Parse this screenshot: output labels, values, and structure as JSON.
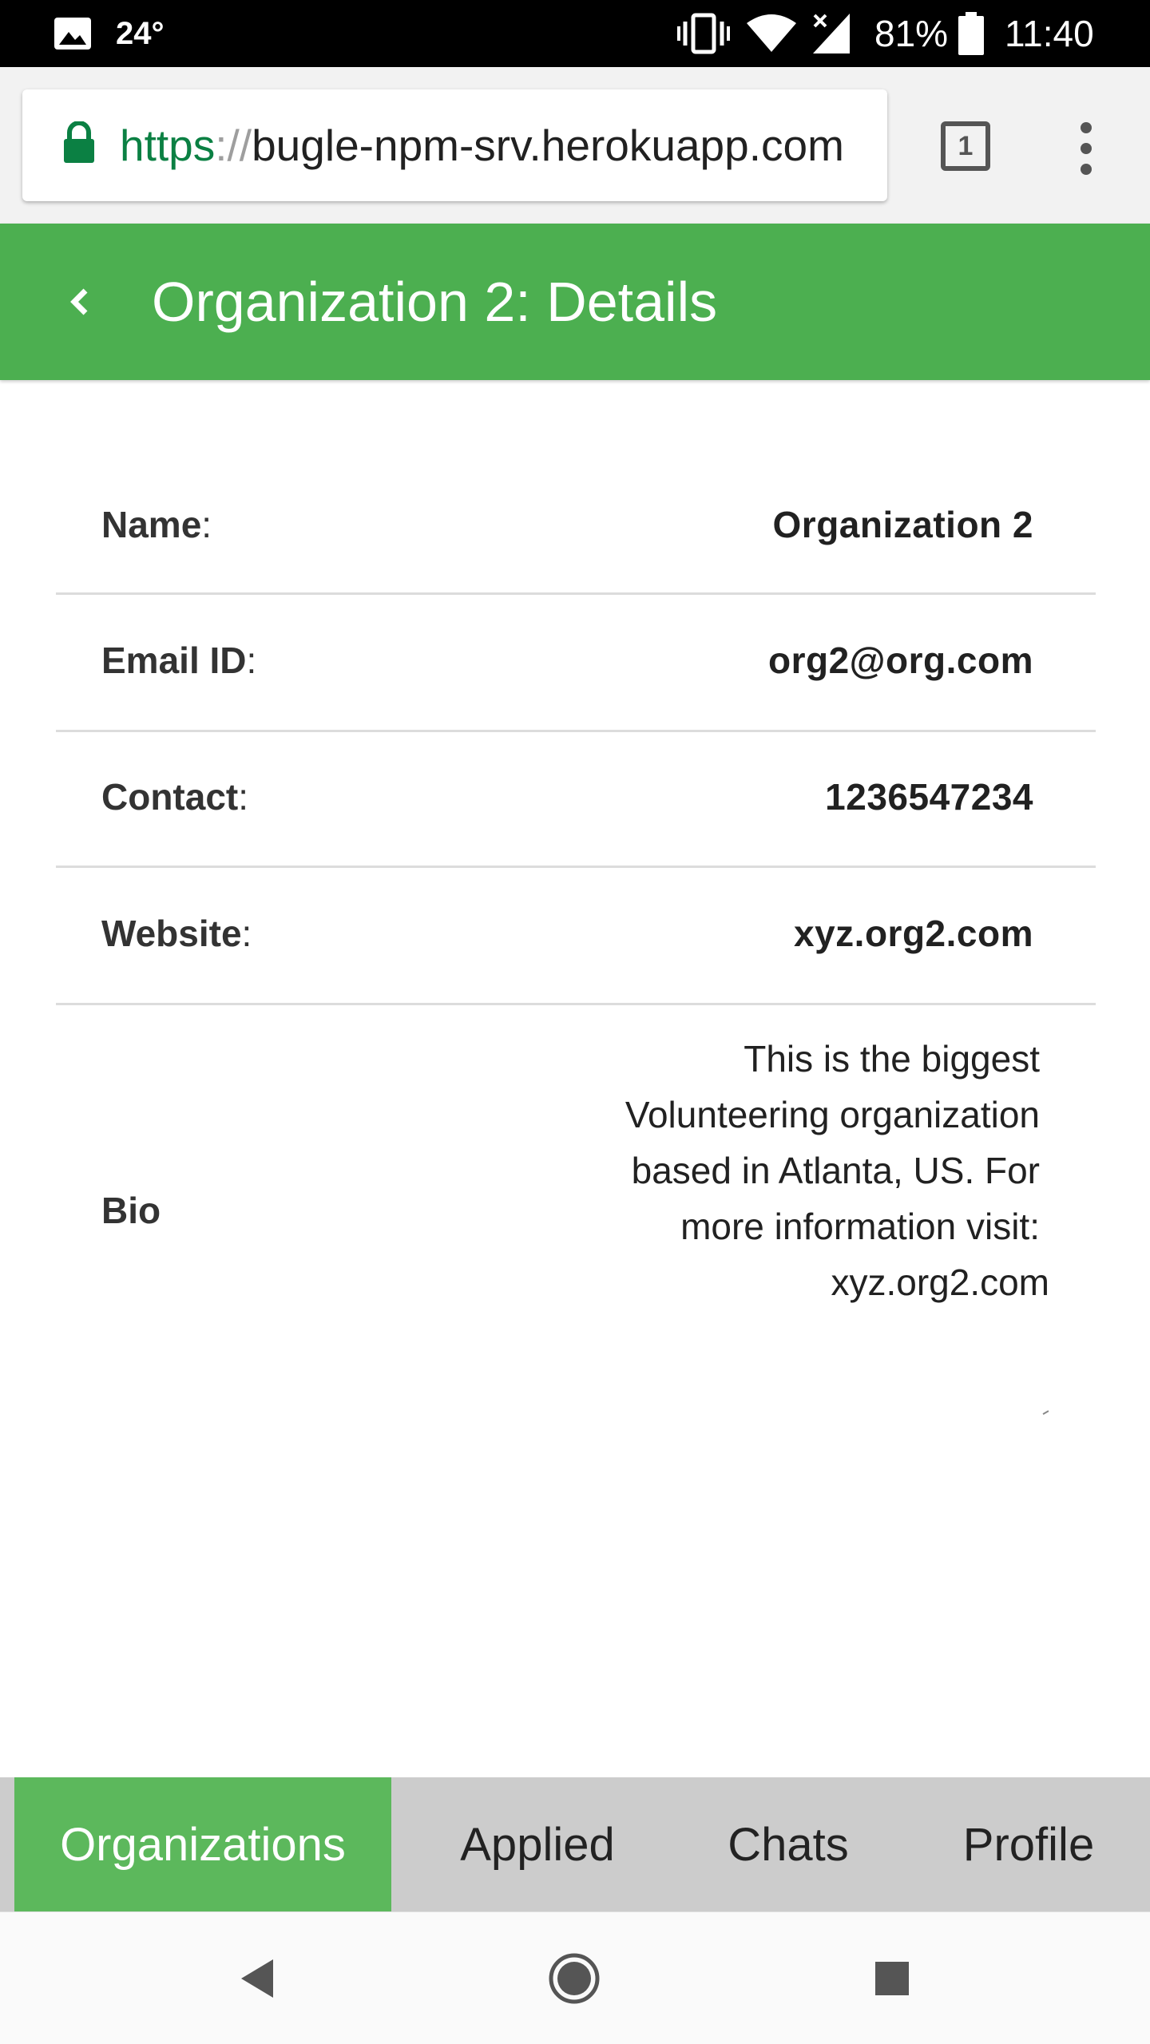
{
  "status_bar": {
    "temperature": "24°",
    "battery": "81%",
    "time": "11:40",
    "icons": [
      "image-notification-icon",
      "vibrate-icon",
      "wifi-icon",
      "cell-signal-icon",
      "battery-icon"
    ]
  },
  "browser": {
    "url_scheme": "https",
    "url_separator": "://",
    "url_host": "bugle-npm-srv.herokuapp.com",
    "tab_count": "1",
    "colors": {
      "secure": "#0b8043"
    }
  },
  "header": {
    "title": "Organization 2: Details",
    "back_icon": "chevron-left-icon",
    "color": "#4caf50"
  },
  "details": {
    "name": {
      "label": "Name",
      "colon": ":",
      "value": "Organization 2"
    },
    "email": {
      "label": "Email ID",
      "colon": ":",
      "value": "org2@org.com"
    },
    "contact": {
      "label": "Contact",
      "colon": ":",
      "value": "1236547234"
    },
    "website": {
      "label": "Website",
      "colon": ":",
      "value": "xyz.org2.com"
    },
    "bio": {
      "label": "Bio",
      "lines": [
        "This is the biggest",
        "Volunteering organization",
        "based in Atlanta, US. For",
        "more information visit:",
        "xyz.org2.com"
      ]
    }
  },
  "tabs": {
    "organizations": "Organizations",
    "applied": "Applied",
    "chats": "Chats",
    "profile": "Profile",
    "active": "Organizations",
    "colors": {
      "active_bg": "#5cb85c",
      "bar_bg": "#cccccc"
    }
  },
  "nav": {
    "icons": [
      "back-triangle-icon",
      "home-circle-icon",
      "recents-square-icon"
    ]
  }
}
